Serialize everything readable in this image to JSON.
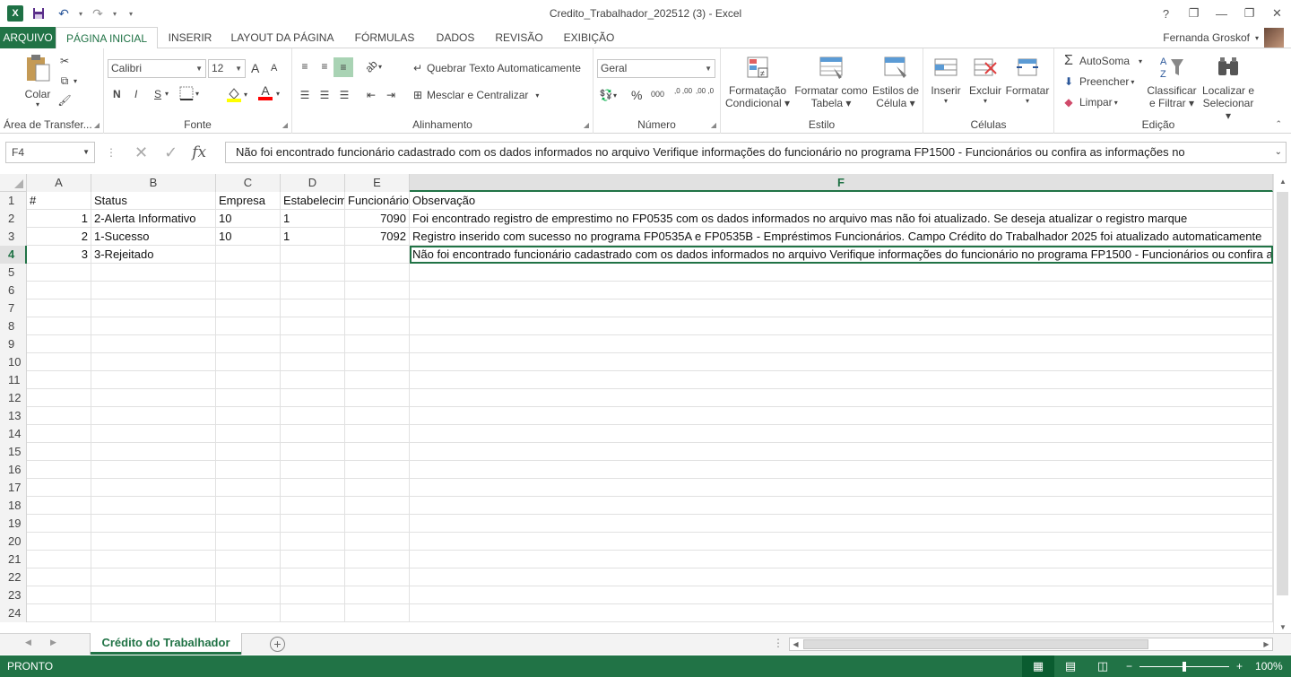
{
  "window": {
    "title": "Credito_Trabalhador_202512 (3) - Excel",
    "help": "?",
    "minimize": "—",
    "restore": "❐",
    "close": "✕"
  },
  "qat": {
    "undo": "↶",
    "redo": "↷",
    "customize": "▾"
  },
  "tabs": [
    {
      "label": "ARQUIVO"
    },
    {
      "label": "PÁGINA INICIAL"
    },
    {
      "label": "INSERIR"
    },
    {
      "label": "LAYOUT DA PÁGINA"
    },
    {
      "label": "FÓRMULAS"
    },
    {
      "label": "DADOS"
    },
    {
      "label": "REVISÃO"
    },
    {
      "label": "EXIBIÇÃO"
    }
  ],
  "user": {
    "name": "Fernanda Groskof"
  },
  "ribbon": {
    "clipboard": {
      "paste": "Colar",
      "label": "Área de Transfer..."
    },
    "font": {
      "name": "Calibri",
      "size": "12",
      "bold": "N",
      "italic": "I",
      "underline": "S",
      "grow": "A",
      "shrink": "A",
      "font_color": "A",
      "label": "Fonte"
    },
    "alignment": {
      "wrap": "Quebrar Texto Automaticamente",
      "merge": "Mesclar e Centralizar",
      "label": "Alinhamento"
    },
    "number": {
      "format": "Geral",
      "percent": "%",
      "thousands": "000",
      "inc_decimal": ",0 ,00",
      "dec_decimal": ",00 ,0",
      "label": "Número"
    },
    "styles": {
      "conditional_1": "Formatação",
      "conditional_2": "Condicional",
      "table_1": "Formatar como",
      "table_2": "Tabela",
      "cell_1": "Estilos de",
      "cell_2": "Célula",
      "label": "Estilo"
    },
    "cells": {
      "insert": "Inserir",
      "delete": "Excluir",
      "format": "Formatar",
      "label": "Células"
    },
    "editing": {
      "autosum": "AutoSoma",
      "fill": "Preencher",
      "clear": "Limpar",
      "sort_1": "Classificar",
      "sort_2": "e Filtrar",
      "find_1": "Localizar e",
      "find_2": "Selecionar",
      "label": "Edição"
    }
  },
  "formula_bar": {
    "name_box": "F4",
    "fx": "fx",
    "value": "Não foi encontrado funcionário cadastrado com os dados informados no arquivo Verifique informações do funcionário no programa FP1500 - Funcionários ou confira as informações no"
  },
  "columns": [
    "A",
    "B",
    "C",
    "D",
    "E",
    "F"
  ],
  "rows": [
    {
      "num": "1",
      "cells": [
        "#",
        "Status",
        "Empresa",
        "Estabelecimento",
        "Funcionário",
        "Observação"
      ]
    },
    {
      "num": "2",
      "cells": [
        "1",
        "2-Alerta Informativo",
        "10",
        "1",
        "7090",
        "Foi encontrado registro de emprestimo no FP0535 com os dados informados no arquivo mas não foi atualizado. Se deseja atualizar o registro marque"
      ]
    },
    {
      "num": "3",
      "cells": [
        "2",
        "1-Sucesso",
        "10",
        "1",
        "7092",
        "Registro inserido com sucesso no programa FP0535A e FP0535B - Empréstimos Funcionários. Campo Crédito do Trabalhador 2025 foi atualizado automaticamente"
      ]
    },
    {
      "num": "4",
      "cells": [
        "3",
        "3-Rejeitado",
        "",
        "",
        "",
        "Não foi encontrado funcionário cadastrado com os dados informados no arquivo Verifique informações do funcionário no programa FP1500 - Funcionários ou confira as informações no"
      ]
    },
    {
      "num": "5",
      "cells": [
        "",
        "",
        "",
        "",
        "",
        ""
      ]
    },
    {
      "num": "6",
      "cells": [
        "",
        "",
        "",
        "",
        "",
        ""
      ]
    },
    {
      "num": "7",
      "cells": [
        "",
        "",
        "",
        "",
        "",
        ""
      ]
    },
    {
      "num": "8",
      "cells": [
        "",
        "",
        "",
        "",
        "",
        ""
      ]
    },
    {
      "num": "9",
      "cells": [
        "",
        "",
        "",
        "",
        "",
        ""
      ]
    },
    {
      "num": "10",
      "cells": [
        "",
        "",
        "",
        "",
        "",
        ""
      ]
    },
    {
      "num": "11",
      "cells": [
        "",
        "",
        "",
        "",
        "",
        ""
      ]
    },
    {
      "num": "12",
      "cells": [
        "",
        "",
        "",
        "",
        "",
        ""
      ]
    },
    {
      "num": "13",
      "cells": [
        "",
        "",
        "",
        "",
        "",
        ""
      ]
    },
    {
      "num": "14",
      "cells": [
        "",
        "",
        "",
        "",
        "",
        ""
      ]
    },
    {
      "num": "15",
      "cells": [
        "",
        "",
        "",
        "",
        "",
        ""
      ]
    },
    {
      "num": "16",
      "cells": [
        "",
        "",
        "",
        "",
        "",
        ""
      ]
    },
    {
      "num": "17",
      "cells": [
        "",
        "",
        "",
        "",
        "",
        ""
      ]
    },
    {
      "num": "18",
      "cells": [
        "",
        "",
        "",
        "",
        "",
        ""
      ]
    },
    {
      "num": "19",
      "cells": [
        "",
        "",
        "",
        "",
        "",
        ""
      ]
    },
    {
      "num": "20",
      "cells": [
        "",
        "",
        "",
        "",
        "",
        ""
      ]
    },
    {
      "num": "21",
      "cells": [
        "",
        "",
        "",
        "",
        "",
        ""
      ]
    },
    {
      "num": "22",
      "cells": [
        "",
        "",
        "",
        "",
        "",
        ""
      ]
    },
    {
      "num": "23",
      "cells": [
        "",
        "",
        "",
        "",
        "",
        ""
      ]
    },
    {
      "num": "24",
      "cells": [
        "",
        "",
        "",
        "",
        "",
        ""
      ]
    }
  ],
  "sheet": {
    "name": "Crédito do Trabalhador",
    "add": "+"
  },
  "status": {
    "text": "PRONTO",
    "zoom": "100%",
    "zoom_out": "−",
    "zoom_in": "+"
  },
  "colors": {
    "accent": "#217346",
    "header_bg": "#f3f3f3"
  },
  "icons": [
    "excel-logo-icon",
    "save-icon",
    "undo-icon",
    "redo-icon",
    "paste-icon",
    "cut-icon",
    "copy-icon",
    "format-painter-icon",
    "fx-icon"
  ]
}
